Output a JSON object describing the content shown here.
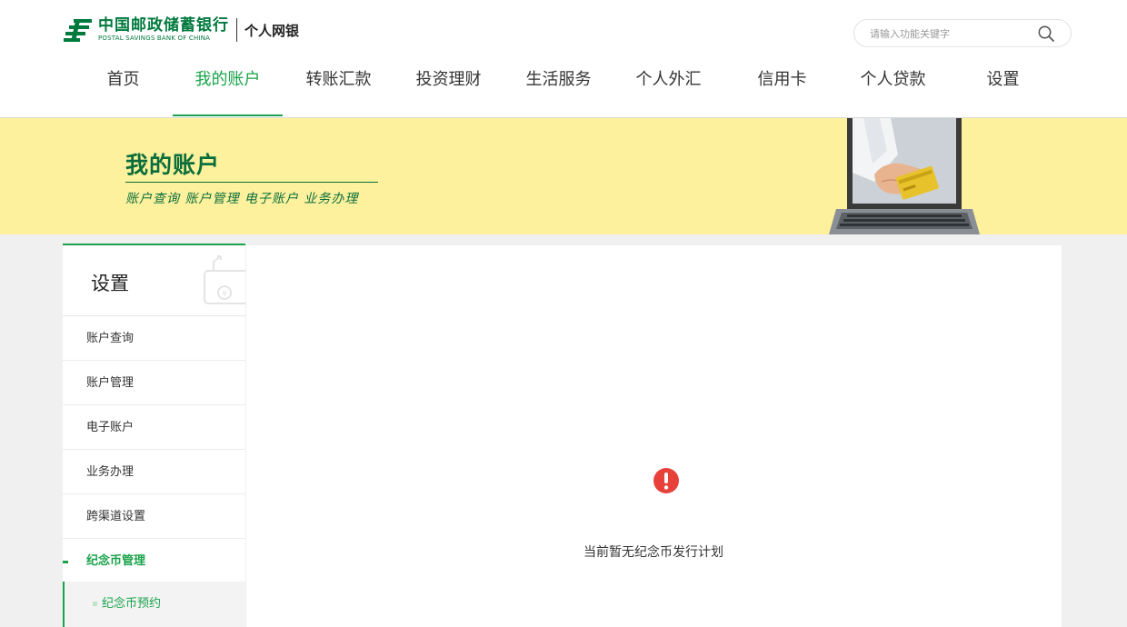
{
  "header": {
    "logo_cn": "中国邮政储蓄银行",
    "logo_en": "POSTAL SAVINGS BANK OF CHINA",
    "logo_sub": "个人网银",
    "brand_color": "#007a3d",
    "search": {
      "placeholder": "请输入功能关键字",
      "icon": "search-icon"
    }
  },
  "nav": {
    "items": [
      {
        "label": "首页"
      },
      {
        "label": "我的账户",
        "active": true
      },
      {
        "label": "转账汇款"
      },
      {
        "label": "投资理财"
      },
      {
        "label": "生活服务"
      },
      {
        "label": "个人外汇"
      },
      {
        "label": "信用卡"
      },
      {
        "label": "个人贷款"
      },
      {
        "label": "设置"
      }
    ],
    "accent_color": "#1aa34a"
  },
  "banner": {
    "title": "我的账户",
    "subtitle": "账户查询 账户管理 电子账户 业务办理",
    "background": "#fdf19e"
  },
  "sidebar": {
    "title": "设置",
    "items": [
      {
        "label": "账户查询"
      },
      {
        "label": "账户管理"
      },
      {
        "label": "电子账户"
      },
      {
        "label": "业务办理"
      },
      {
        "label": "跨渠道设置"
      },
      {
        "label": "纪念币管理",
        "active": true
      }
    ],
    "sub_items": [
      {
        "label": "纪念币预约"
      }
    ]
  },
  "main": {
    "icon": "alert-icon",
    "message": "当前暂无纪念币发行计划",
    "alert_color": "#e8413a"
  }
}
